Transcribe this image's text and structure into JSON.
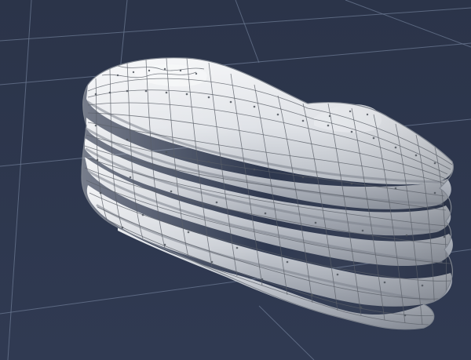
{
  "viewport": {
    "background_color": "#2d374e",
    "grid_color": "#6b7891",
    "mesh": {
      "surface_color": "#e1e4e9",
      "shadow_color": "#8f95a0",
      "wire_color": "#5a5f68",
      "vertex_color": "#4d535c"
    }
  }
}
